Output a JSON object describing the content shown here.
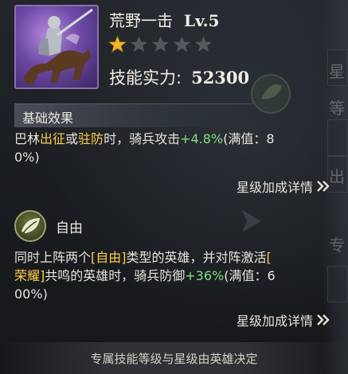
{
  "skill": {
    "name": "荒野一击",
    "level": "Lv.5",
    "stars_filled": 1,
    "stars_total": 5,
    "power_label": "技能实力:",
    "power_value": "52300"
  },
  "basic_effect": {
    "header": "基础效果",
    "line1_parts": [
      "巴林",
      "出征",
      "或",
      "驻防",
      "时，骑兵攻击",
      "+4.8%",
      "(满值：8"
    ],
    "line2": "0%)",
    "star_link": "星级加成详情"
  },
  "free_skill": {
    "name": "自由",
    "line1_parts": [
      "同时上阵两个",
      "[自由]",
      "类型的英雄，并对阵激活",
      "["
    ],
    "line2_parts": [
      "荣耀]",
      "共鸣的英雄时，骑兵防御",
      "+36%",
      "(满值：6"
    ],
    "line3": "00%)",
    "star_link": "星级加成详情"
  },
  "footer": "专属技能等级与星级由英雄决定",
  "background_chars": [
    "星",
    "等",
    "出",
    "专"
  ],
  "colors": {
    "highlight": "#ffcc4d",
    "positive": "#7fe07f",
    "star_filled": "#f0b429",
    "star_empty": "#5a5a5a"
  }
}
